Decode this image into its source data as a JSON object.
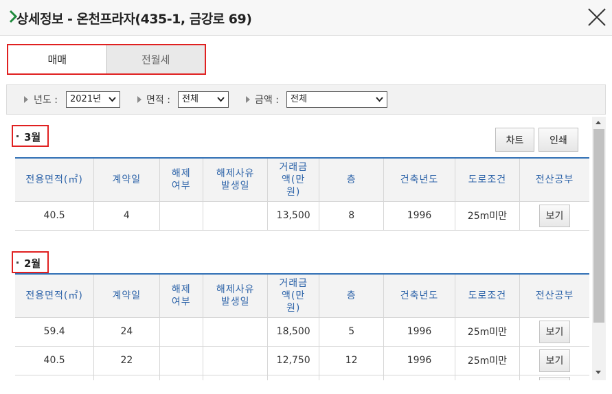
{
  "window": {
    "title": "상세정보 - 온천프라자(435-1, 금강로 69)"
  },
  "tabs": [
    {
      "label": "매매",
      "active": true
    },
    {
      "label": "전월세",
      "active": false
    }
  ],
  "filters": {
    "year": {
      "label": "년도 :",
      "value": "2021년"
    },
    "area": {
      "label": "면적 :",
      "value": "전체"
    },
    "amount": {
      "label": "금액 :",
      "value": "전체"
    }
  },
  "actions": {
    "chart_label": "차트",
    "print_label": "인쇄"
  },
  "columns": [
    "전용면적(㎡)",
    "계약일",
    "해제\n여부",
    "해제사유\n발생일",
    "거래금\n액(만\n원)",
    "층",
    "건축년도",
    "도로조건",
    "전산공부"
  ],
  "view_label": "보기",
  "sections": [
    {
      "month": "3월",
      "rows": [
        {
          "area": "40.5",
          "day": "4",
          "cancel": "",
          "cancel_date": "",
          "price": "13,500",
          "floor": "8",
          "year": "1996",
          "road": "25m미만"
        }
      ]
    },
    {
      "month": "2월",
      "rows": [
        {
          "area": "59.4",
          "day": "24",
          "cancel": "",
          "cancel_date": "",
          "price": "18,500",
          "floor": "5",
          "year": "1996",
          "road": "25m미만"
        },
        {
          "area": "40.5",
          "day": "22",
          "cancel": "",
          "cancel_date": "",
          "price": "12,750",
          "floor": "12",
          "year": "1996",
          "road": "25m미만"
        }
      ]
    }
  ],
  "colors": {
    "accent_red": "#e02020",
    "header_blue": "#2b62a8",
    "title_chevron": "#1e8a3c"
  }
}
